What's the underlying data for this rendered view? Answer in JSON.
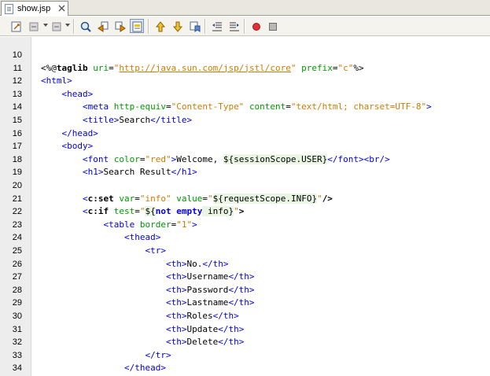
{
  "tab": {
    "title": "show.jsp"
  },
  "toolbar": {
    "buttons": [
      "last-edit-icon",
      "back-icon",
      "forward-icon",
      "find-selection-icon",
      "find-previous-icon",
      "find-next-icon",
      "toggle-highlight-icon",
      "prev-bookmark-icon",
      "next-bookmark-icon",
      "toggle-bookmark-icon",
      "shift-left-icon",
      "shift-right-icon",
      "record-macro-icon",
      "stop-macro-icon"
    ]
  },
  "colors": {
    "tag": "#0000e6",
    "attribute": "#009900",
    "value": "#ce7b00",
    "el_background": "#eaf5e4"
  },
  "editor": {
    "lines": [
      {
        "number": "10",
        "tokens": []
      },
      {
        "number": "11",
        "tokens": [
          {
            "t": "dir",
            "v": "<%@"
          },
          {
            "t": "dirname",
            "v": "taglib"
          },
          {
            "t": "text",
            "v": " "
          },
          {
            "t": "attr",
            "v": "uri"
          },
          {
            "t": "text",
            "v": "="
          },
          {
            "t": "val",
            "v": "\""
          },
          {
            "t": "link",
            "v": "http://java.sun.com/jsp/jstl/core"
          },
          {
            "t": "val",
            "v": "\""
          },
          {
            "t": "text",
            "v": " "
          },
          {
            "t": "attr",
            "v": "prefix"
          },
          {
            "t": "text",
            "v": "="
          },
          {
            "t": "val",
            "v": "\"c\""
          },
          {
            "t": "dir",
            "v": "%>"
          }
        ]
      },
      {
        "number": "12",
        "tokens": [
          {
            "t": "tag",
            "v": "<html>"
          }
        ]
      },
      {
        "number": "13",
        "tokens": [
          {
            "t": "text",
            "v": "    "
          },
          {
            "t": "tag",
            "v": "<head>"
          }
        ]
      },
      {
        "number": "14",
        "tokens": [
          {
            "t": "text",
            "v": "        "
          },
          {
            "t": "tag",
            "v": "<meta"
          },
          {
            "t": "text",
            "v": " "
          },
          {
            "t": "attr",
            "v": "http-equiv"
          },
          {
            "t": "text",
            "v": "="
          },
          {
            "t": "val",
            "v": "\"Content-Type\""
          },
          {
            "t": "text",
            "v": " "
          },
          {
            "t": "attr",
            "v": "content"
          },
          {
            "t": "text",
            "v": "="
          },
          {
            "t": "val",
            "v": "\"text/html; charset=UTF-8\""
          },
          {
            "t": "tag",
            "v": ">"
          }
        ]
      },
      {
        "number": "15",
        "tokens": [
          {
            "t": "text",
            "v": "        "
          },
          {
            "t": "tag",
            "v": "<title>"
          },
          {
            "t": "text",
            "v": "Search"
          },
          {
            "t": "tag",
            "v": "</title>"
          }
        ]
      },
      {
        "number": "16",
        "tokens": [
          {
            "t": "text",
            "v": "    "
          },
          {
            "t": "tag",
            "v": "</head>"
          }
        ]
      },
      {
        "number": "17",
        "tokens": [
          {
            "t": "text",
            "v": "    "
          },
          {
            "t": "tag",
            "v": "<body>"
          }
        ]
      },
      {
        "number": "18",
        "tokens": [
          {
            "t": "text",
            "v": "        "
          },
          {
            "t": "tag",
            "v": "<font"
          },
          {
            "t": "text",
            "v": " "
          },
          {
            "t": "attr",
            "v": "color"
          },
          {
            "t": "text",
            "v": "="
          },
          {
            "t": "val",
            "v": "\"red\""
          },
          {
            "t": "tag",
            "v": ">"
          },
          {
            "t": "text",
            "v": "Welcome, "
          },
          {
            "t": "el",
            "v": "${sessionScope.USER}"
          },
          {
            "t": "tag",
            "v": "</font><br/>"
          }
        ]
      },
      {
        "number": "19",
        "tokens": [
          {
            "t": "text",
            "v": "        "
          },
          {
            "t": "tag",
            "v": "<h1>"
          },
          {
            "t": "text",
            "v": "Search Result"
          },
          {
            "t": "tag",
            "v": "</h1>"
          }
        ]
      },
      {
        "number": "20",
        "tokens": []
      },
      {
        "number": "21",
        "tokens": [
          {
            "t": "text",
            "v": "        "
          },
          {
            "t": "tag",
            "v": "<"
          },
          {
            "t": "jsp",
            "v": "c:set"
          },
          {
            "t": "text",
            "v": " "
          },
          {
            "t": "attr",
            "v": "var"
          },
          {
            "t": "text",
            "v": "="
          },
          {
            "t": "val",
            "v": "\"info\""
          },
          {
            "t": "text",
            "v": " "
          },
          {
            "t": "attr",
            "v": "value"
          },
          {
            "t": "text",
            "v": "="
          },
          {
            "t": "val",
            "v": "\""
          },
          {
            "t": "el",
            "v": "${requestScope.INFO}"
          },
          {
            "t": "val",
            "v": "\""
          },
          {
            "t": "jsp",
            "v": "/>"
          }
        ]
      },
      {
        "number": "22",
        "tokens": [
          {
            "t": "text",
            "v": "        "
          },
          {
            "t": "tag",
            "v": "<"
          },
          {
            "t": "jsp",
            "v": "c:if"
          },
          {
            "t": "text",
            "v": " "
          },
          {
            "t": "attr",
            "v": "test"
          },
          {
            "t": "text",
            "v": "="
          },
          {
            "t": "val",
            "v": "\""
          },
          {
            "t": "el",
            "v": "${"
          },
          {
            "t": "elkw",
            "v": "not empty"
          },
          {
            "t": "el",
            "v": " info}"
          },
          {
            "t": "val",
            "v": "\""
          },
          {
            "t": "jsp",
            "v": ">"
          }
        ]
      },
      {
        "number": "23",
        "tokens": [
          {
            "t": "text",
            "v": "            "
          },
          {
            "t": "tag",
            "v": "<table"
          },
          {
            "t": "text",
            "v": " "
          },
          {
            "t": "attr",
            "v": "border"
          },
          {
            "t": "text",
            "v": "="
          },
          {
            "t": "val",
            "v": "\"1\""
          },
          {
            "t": "tag",
            "v": ">"
          }
        ]
      },
      {
        "number": "24",
        "tokens": [
          {
            "t": "text",
            "v": "                "
          },
          {
            "t": "tag",
            "v": "<thead>"
          }
        ]
      },
      {
        "number": "25",
        "tokens": [
          {
            "t": "text",
            "v": "                    "
          },
          {
            "t": "tag",
            "v": "<tr>"
          }
        ]
      },
      {
        "number": "26",
        "tokens": [
          {
            "t": "text",
            "v": "                        "
          },
          {
            "t": "tag",
            "v": "<th>"
          },
          {
            "t": "text",
            "v": "No."
          },
          {
            "t": "tag",
            "v": "</th>"
          }
        ]
      },
      {
        "number": "27",
        "tokens": [
          {
            "t": "text",
            "v": "                        "
          },
          {
            "t": "tag",
            "v": "<th>"
          },
          {
            "t": "text",
            "v": "Username"
          },
          {
            "t": "tag",
            "v": "</th>"
          }
        ]
      },
      {
        "number": "28",
        "tokens": [
          {
            "t": "text",
            "v": "                        "
          },
          {
            "t": "tag",
            "v": "<th>"
          },
          {
            "t": "text",
            "v": "Password"
          },
          {
            "t": "tag",
            "v": "</th>"
          }
        ]
      },
      {
        "number": "29",
        "tokens": [
          {
            "t": "text",
            "v": "                        "
          },
          {
            "t": "tag",
            "v": "<th>"
          },
          {
            "t": "text",
            "v": "Lastname"
          },
          {
            "t": "tag",
            "v": "</th>"
          }
        ]
      },
      {
        "number": "30",
        "tokens": [
          {
            "t": "text",
            "v": "                        "
          },
          {
            "t": "tag",
            "v": "<th>"
          },
          {
            "t": "text",
            "v": "Roles"
          },
          {
            "t": "tag",
            "v": "</th>"
          }
        ]
      },
      {
        "number": "31",
        "tokens": [
          {
            "t": "text",
            "v": "                        "
          },
          {
            "t": "tag",
            "v": "<th>"
          },
          {
            "t": "text",
            "v": "Update"
          },
          {
            "t": "tag",
            "v": "</th>"
          }
        ]
      },
      {
        "number": "32",
        "tokens": [
          {
            "t": "text",
            "v": "                        "
          },
          {
            "t": "tag",
            "v": "<th>"
          },
          {
            "t": "text",
            "v": "Delete"
          },
          {
            "t": "tag",
            "v": "</th>"
          }
        ]
      },
      {
        "number": "33",
        "tokens": [
          {
            "t": "text",
            "v": "                    "
          },
          {
            "t": "tag",
            "v": "</tr>"
          }
        ]
      },
      {
        "number": "34",
        "tokens": [
          {
            "t": "text",
            "v": "                "
          },
          {
            "t": "tag",
            "v": "</thead>"
          }
        ]
      }
    ]
  }
}
